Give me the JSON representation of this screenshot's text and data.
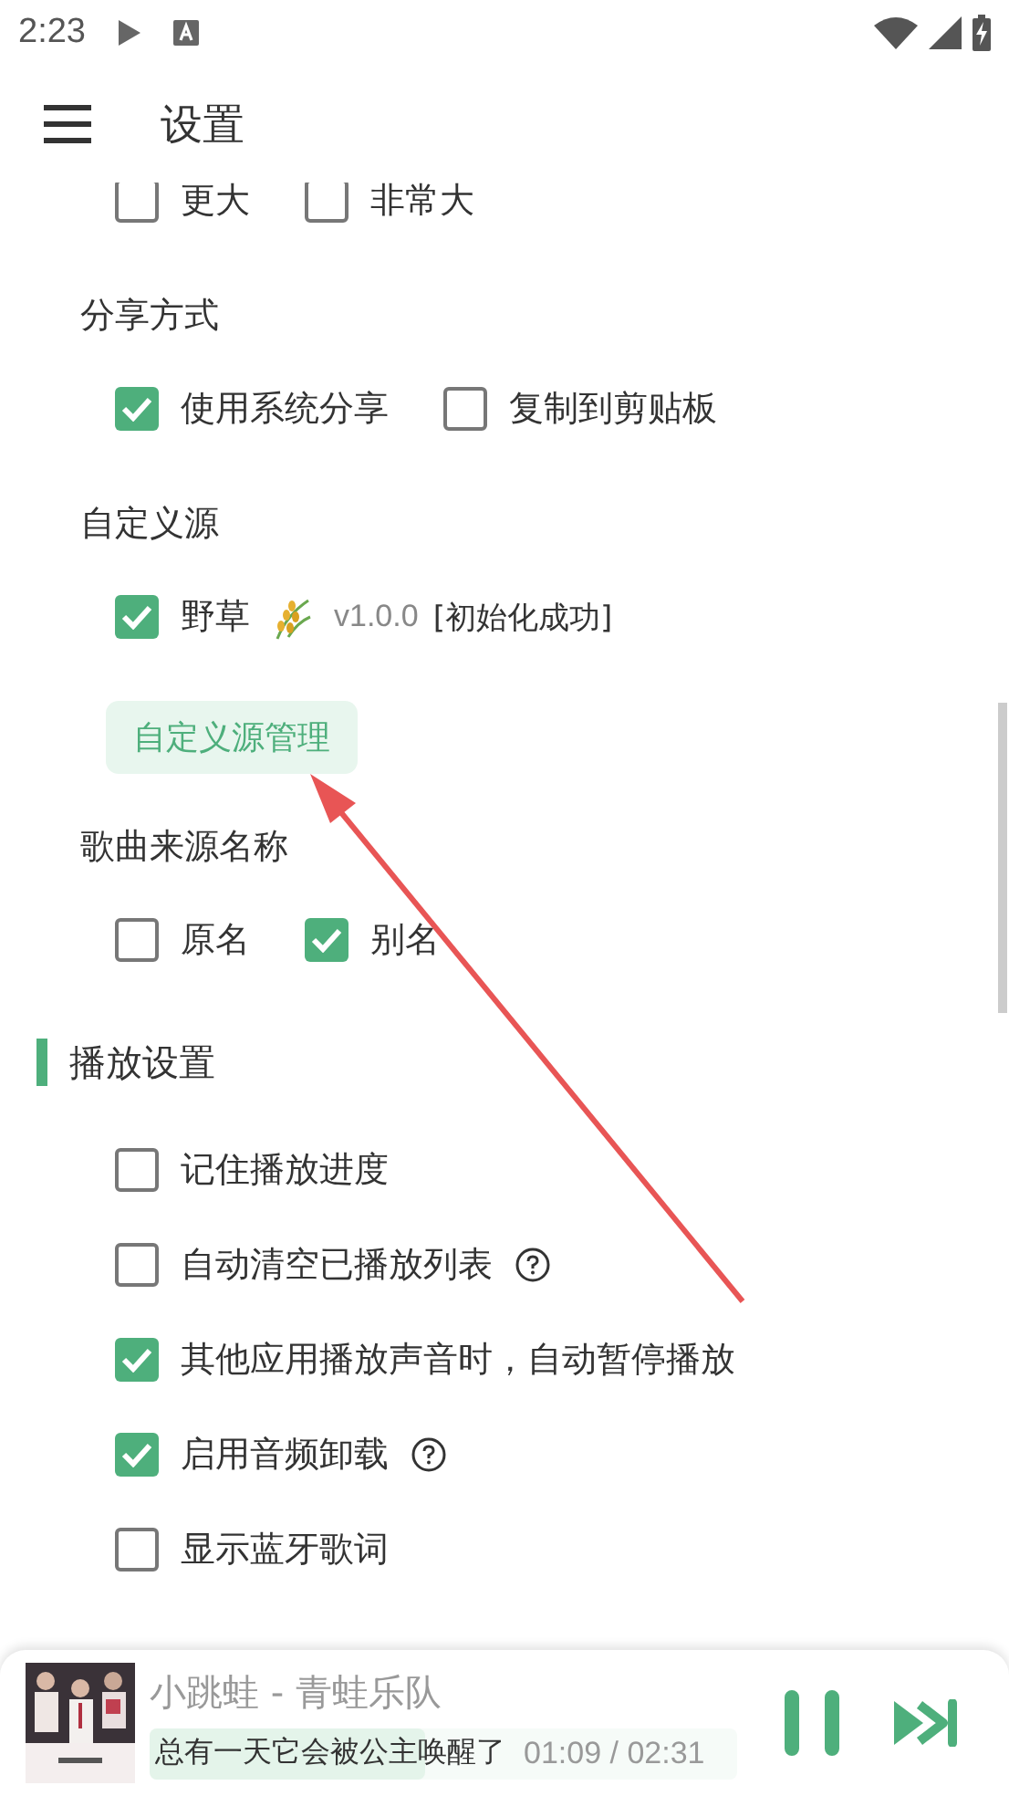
{
  "status_bar": {
    "time": "2:23"
  },
  "app_bar": {
    "title": "设置"
  },
  "items": [
    {
      "kind": "option_row",
      "options": [
        {
          "label": "更大",
          "checked": false
        },
        {
          "label": "非常大",
          "checked": false
        }
      ]
    },
    {
      "kind": "label",
      "text": "分享方式"
    },
    {
      "kind": "option_row",
      "options": [
        {
          "label": "使用系统分享",
          "checked": true
        },
        {
          "label": "复制到剪贴板",
          "checked": false
        }
      ]
    },
    {
      "kind": "label",
      "text": "自定义源"
    },
    {
      "kind": "option_row",
      "options": [
        {
          "label": "野草",
          "checked": true,
          "version": "v1.0.0",
          "status": "[初始化成功]"
        }
      ]
    },
    {
      "kind": "button",
      "text": "自定义源管理"
    },
    {
      "kind": "label",
      "text": "歌曲来源名称"
    },
    {
      "kind": "option_row",
      "options": [
        {
          "label": "原名",
          "checked": false
        },
        {
          "label": "别名",
          "checked": true
        }
      ]
    },
    {
      "kind": "header",
      "text": "播放设置"
    },
    {
      "kind": "option",
      "label": "记住播放进度",
      "checked": false,
      "help": false
    },
    {
      "kind": "option",
      "label": "自动清空已播放列表",
      "checked": false,
      "help": true
    },
    {
      "kind": "option",
      "label": "其他应用播放声音时，自动暂停播放",
      "checked": true,
      "help": false
    },
    {
      "kind": "option",
      "label": "启用音频卸载",
      "checked": true,
      "help": true
    },
    {
      "kind": "option",
      "label": "显示蓝牙歌词",
      "checked": false,
      "help": false
    }
  ],
  "player": {
    "title": "小跳蛙 - 青蛙乐队",
    "lyric": "总有一天它会被公主唤醒了",
    "time": "01:09 / 02:31",
    "level": 0.47,
    "playing": true
  }
}
